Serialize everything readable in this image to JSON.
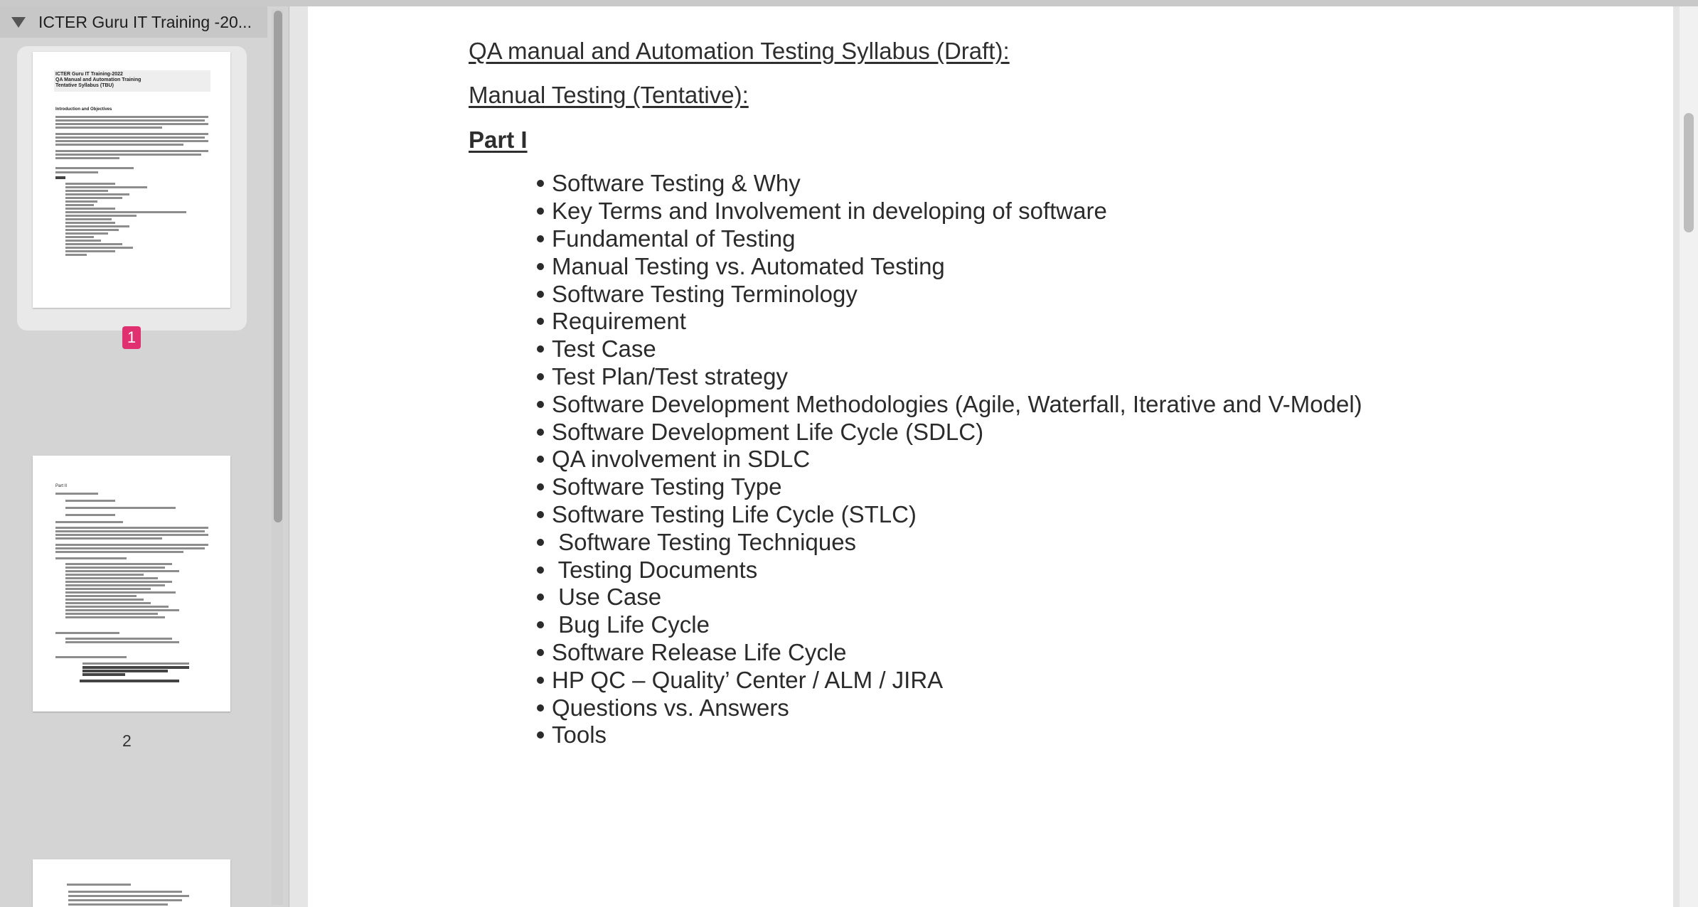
{
  "sidebar": {
    "document_title": "ICTER Guru IT Training -20...",
    "pages": [
      {
        "number": "1",
        "selected": true
      },
      {
        "number": "2",
        "selected": false
      }
    ],
    "thumb1": {
      "title_lines": [
        "ICTER Guru IT Training-2022",
        "QA Manual and Automation Training",
        "Tentative Syllabus (TBU)"
      ],
      "section": "Introduction and Objectives"
    },
    "thumb2": {
      "heading": "Part II"
    }
  },
  "document": {
    "heading": "QA manual and Automation Testing Syllabus (Draft):",
    "subheading": "Manual Testing (Tentative):",
    "part_label": "Part I",
    "topics": [
      "Software Testing & Why",
      "Key Terms and Involvement in developing of software",
      "Fundamental of Testing",
      "Manual Testing vs. Automated Testing",
      "Software Testing Terminology",
      "Requirement",
      "Test Case",
      "Test Plan/Test strategy",
      "Software Development Methodologies (Agile, Waterfall, Iterative and V-Model)",
      "Software Development Life Cycle (SDLC)",
      "QA involvement in SDLC",
      "Software Testing Type",
      "Software Testing Life Cycle (STLC)",
      " Software Testing Techniques",
      " Testing Documents",
      " Use Case",
      " Bug Life Cycle",
      "Software Release Life Cycle",
      "HP QC – Quality’ Center / ALM / JIRA",
      "Questions vs. Answers",
      "Tools"
    ]
  },
  "colors": {
    "selection_badge": "#e0306f",
    "sidebar_bg": "#d4d4d4",
    "page_bg": "#ffffff"
  }
}
